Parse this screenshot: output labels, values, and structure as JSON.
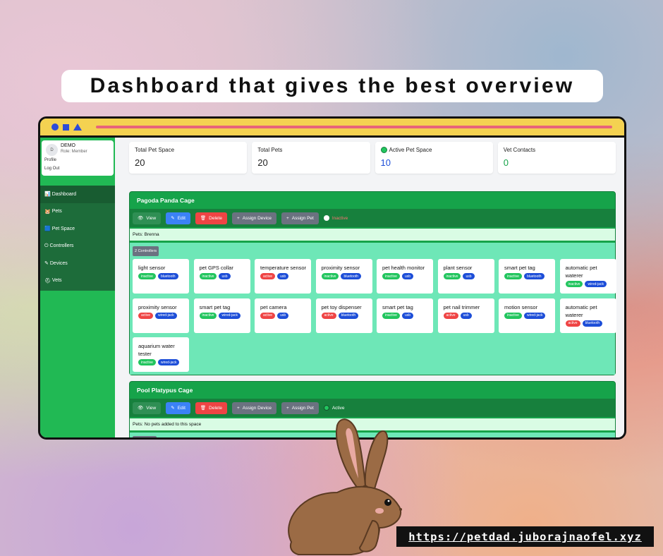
{
  "headline": "Dashboard that gives the best overview",
  "url": "https://petdad.juborajnaofel.xyz",
  "user": {
    "avatar": "D",
    "name": "DEMO",
    "role": "Role: Member",
    "profile": "Profile",
    "logout": "Log Out"
  },
  "nav": [
    {
      "icon": "📊",
      "label": "Dashboard"
    },
    {
      "icon": "🐹",
      "label": "Pets"
    },
    {
      "icon": "🟦",
      "label": "Pet Space"
    },
    {
      "icon": "⏻",
      "label": "Controllers"
    },
    {
      "icon": "✎",
      "label": "Devices"
    },
    {
      "icon": "⛑",
      "label": "Vets"
    }
  ],
  "stats": [
    {
      "label": "Total Pet Space",
      "value": "20"
    },
    {
      "label": "Total Pets",
      "value": "20"
    },
    {
      "label": "Active Pet Space",
      "value": "10"
    },
    {
      "label": "Vet Contacts",
      "value": "0"
    }
  ],
  "buttons": {
    "view": "View",
    "edit": "Edit",
    "delete": "Delete",
    "assign_device": "Assign Device",
    "assign_pet": "Assign Pet"
  },
  "cages": [
    {
      "name": "Pagoda Panda Cage",
      "status": "Inactive",
      "pets": "Pets: Brenna",
      "controllers": "2 Controllers",
      "devices": [
        {
          "name": "light sensor",
          "state": "inactive",
          "conn": "bluetooth"
        },
        {
          "name": "pet GPS collar",
          "state": "inactive",
          "conn": "usb"
        },
        {
          "name": "temperature sensor",
          "state": "active",
          "conn": "usb"
        },
        {
          "name": "proximity sensor",
          "state": "inactive",
          "conn": "bluetooth"
        },
        {
          "name": "pet health monitor",
          "state": "inactive",
          "conn": "usb"
        },
        {
          "name": "plant sensor",
          "state": "inactive",
          "conn": "usb"
        },
        {
          "name": "smart pet tag",
          "state": "inactive",
          "conn": "bluetooth"
        },
        {
          "name": "automatic pet waterer",
          "state": "inactive",
          "conn": "wired-jack"
        },
        {
          "name": "proximity sensor",
          "state": "active",
          "conn": "wired-jack"
        },
        {
          "name": "smart pet tag",
          "state": "inactive",
          "conn": "wired-jack"
        },
        {
          "name": "pet camera",
          "state": "active",
          "conn": "usb"
        },
        {
          "name": "pet toy dispenser",
          "state": "active",
          "conn": "bluetooth"
        },
        {
          "name": "smart pet tag",
          "state": "inactive",
          "conn": "usb"
        },
        {
          "name": "pet nail trimmer",
          "state": "active",
          "conn": "usb"
        },
        {
          "name": "motion sensor",
          "state": "inactive",
          "conn": "wired-jack"
        },
        {
          "name": "automatic pet waterer",
          "state": "active",
          "conn": "bluetooth"
        },
        {
          "name": "aquarium water tester",
          "state": "inactive",
          "conn": "wired-jack"
        }
      ]
    },
    {
      "name": "Pool Platypus Cage",
      "status": "Active",
      "pets": "Pets: No pets added to this space",
      "controllers": "1 Controller",
      "devices": []
    }
  ]
}
